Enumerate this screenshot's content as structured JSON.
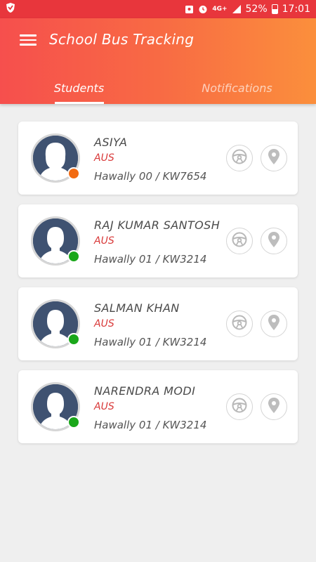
{
  "status_bar": {
    "network": "4G+",
    "battery": "52%",
    "battery_level": 0.52,
    "time": "17:01",
    "icons": [
      "shield-icon",
      "photo-icon",
      "alarm-icon",
      "signal-icon",
      "battery-icon"
    ]
  },
  "app": {
    "title": "School Bus Tracking",
    "menu_icon": "hamburger-icon"
  },
  "tabs": [
    {
      "label": "Students",
      "active": true
    },
    {
      "label": "Notifications",
      "active": false
    }
  ],
  "colors": {
    "header_gradient_start": "#f64f4d",
    "header_gradient_end": "#fb8f3c",
    "status_orange": "#f26b12",
    "status_green": "#1aa71a",
    "school_red": "#d93a3a"
  },
  "students": [
    {
      "name": "ASIYA",
      "school": "AUS",
      "route": "Hawally 00 / KW7654",
      "avatar": "female-avatar-icon",
      "status_color": "#f26b12"
    },
    {
      "name": "RAJ KUMAR SANTOSH",
      "school": "AUS",
      "route": "Hawally 01 / KW3214",
      "avatar": "male-avatar-icon",
      "status_color": "#1aa71a"
    },
    {
      "name": "SALMAN KHAN",
      "school": "AUS",
      "route": "Hawally 01 / KW3214",
      "avatar": "male-avatar-icon",
      "status_color": "#1aa71a"
    },
    {
      "name": "NARENDRA MODI",
      "school": "AUS",
      "route": "Hawally 01 / KW3214",
      "avatar": "male-avatar-icon",
      "status_color": "#1aa71a"
    }
  ],
  "card_actions": [
    "steering-wheel-icon",
    "location-pin-icon"
  ]
}
